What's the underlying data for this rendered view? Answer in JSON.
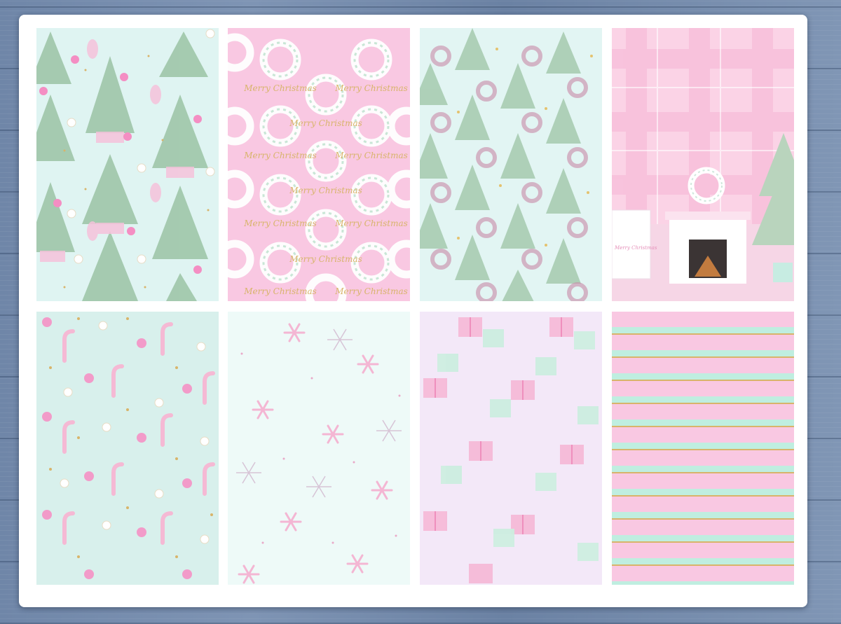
{
  "colors": {
    "mint": "#dff4f2",
    "pink": "#f9c8e2",
    "light_pink": "#fbd3e6",
    "lavender": "#f3e8f8",
    "gold": "#d8b46a",
    "tree_green": "#9fc6a9",
    "ornament_pink": "#f48ec3",
    "wood_blue": "#748bad"
  },
  "patterns": [
    {
      "name": "Christmas trees and ornaments",
      "icon": "christmas-tree-icon"
    },
    {
      "name": "Wreaths with Merry Christmas text",
      "icon": "wreath-icon",
      "text": "Merry Christmas"
    },
    {
      "name": "Trees, wreaths and stars",
      "icon": "wreath-icon"
    },
    {
      "name": "Plaid with fireplace scene",
      "icon": "fireplace-icon",
      "sign_text": "Merry Christmas"
    },
    {
      "name": "Candy canes and ornaments",
      "icon": "candy-cane-icon"
    },
    {
      "name": "Snowflakes",
      "icon": "snowflake-icon"
    },
    {
      "name": "Gift boxes",
      "icon": "gift-icon"
    },
    {
      "name": "Stripes",
      "icon": "stripe-icon"
    }
  ]
}
